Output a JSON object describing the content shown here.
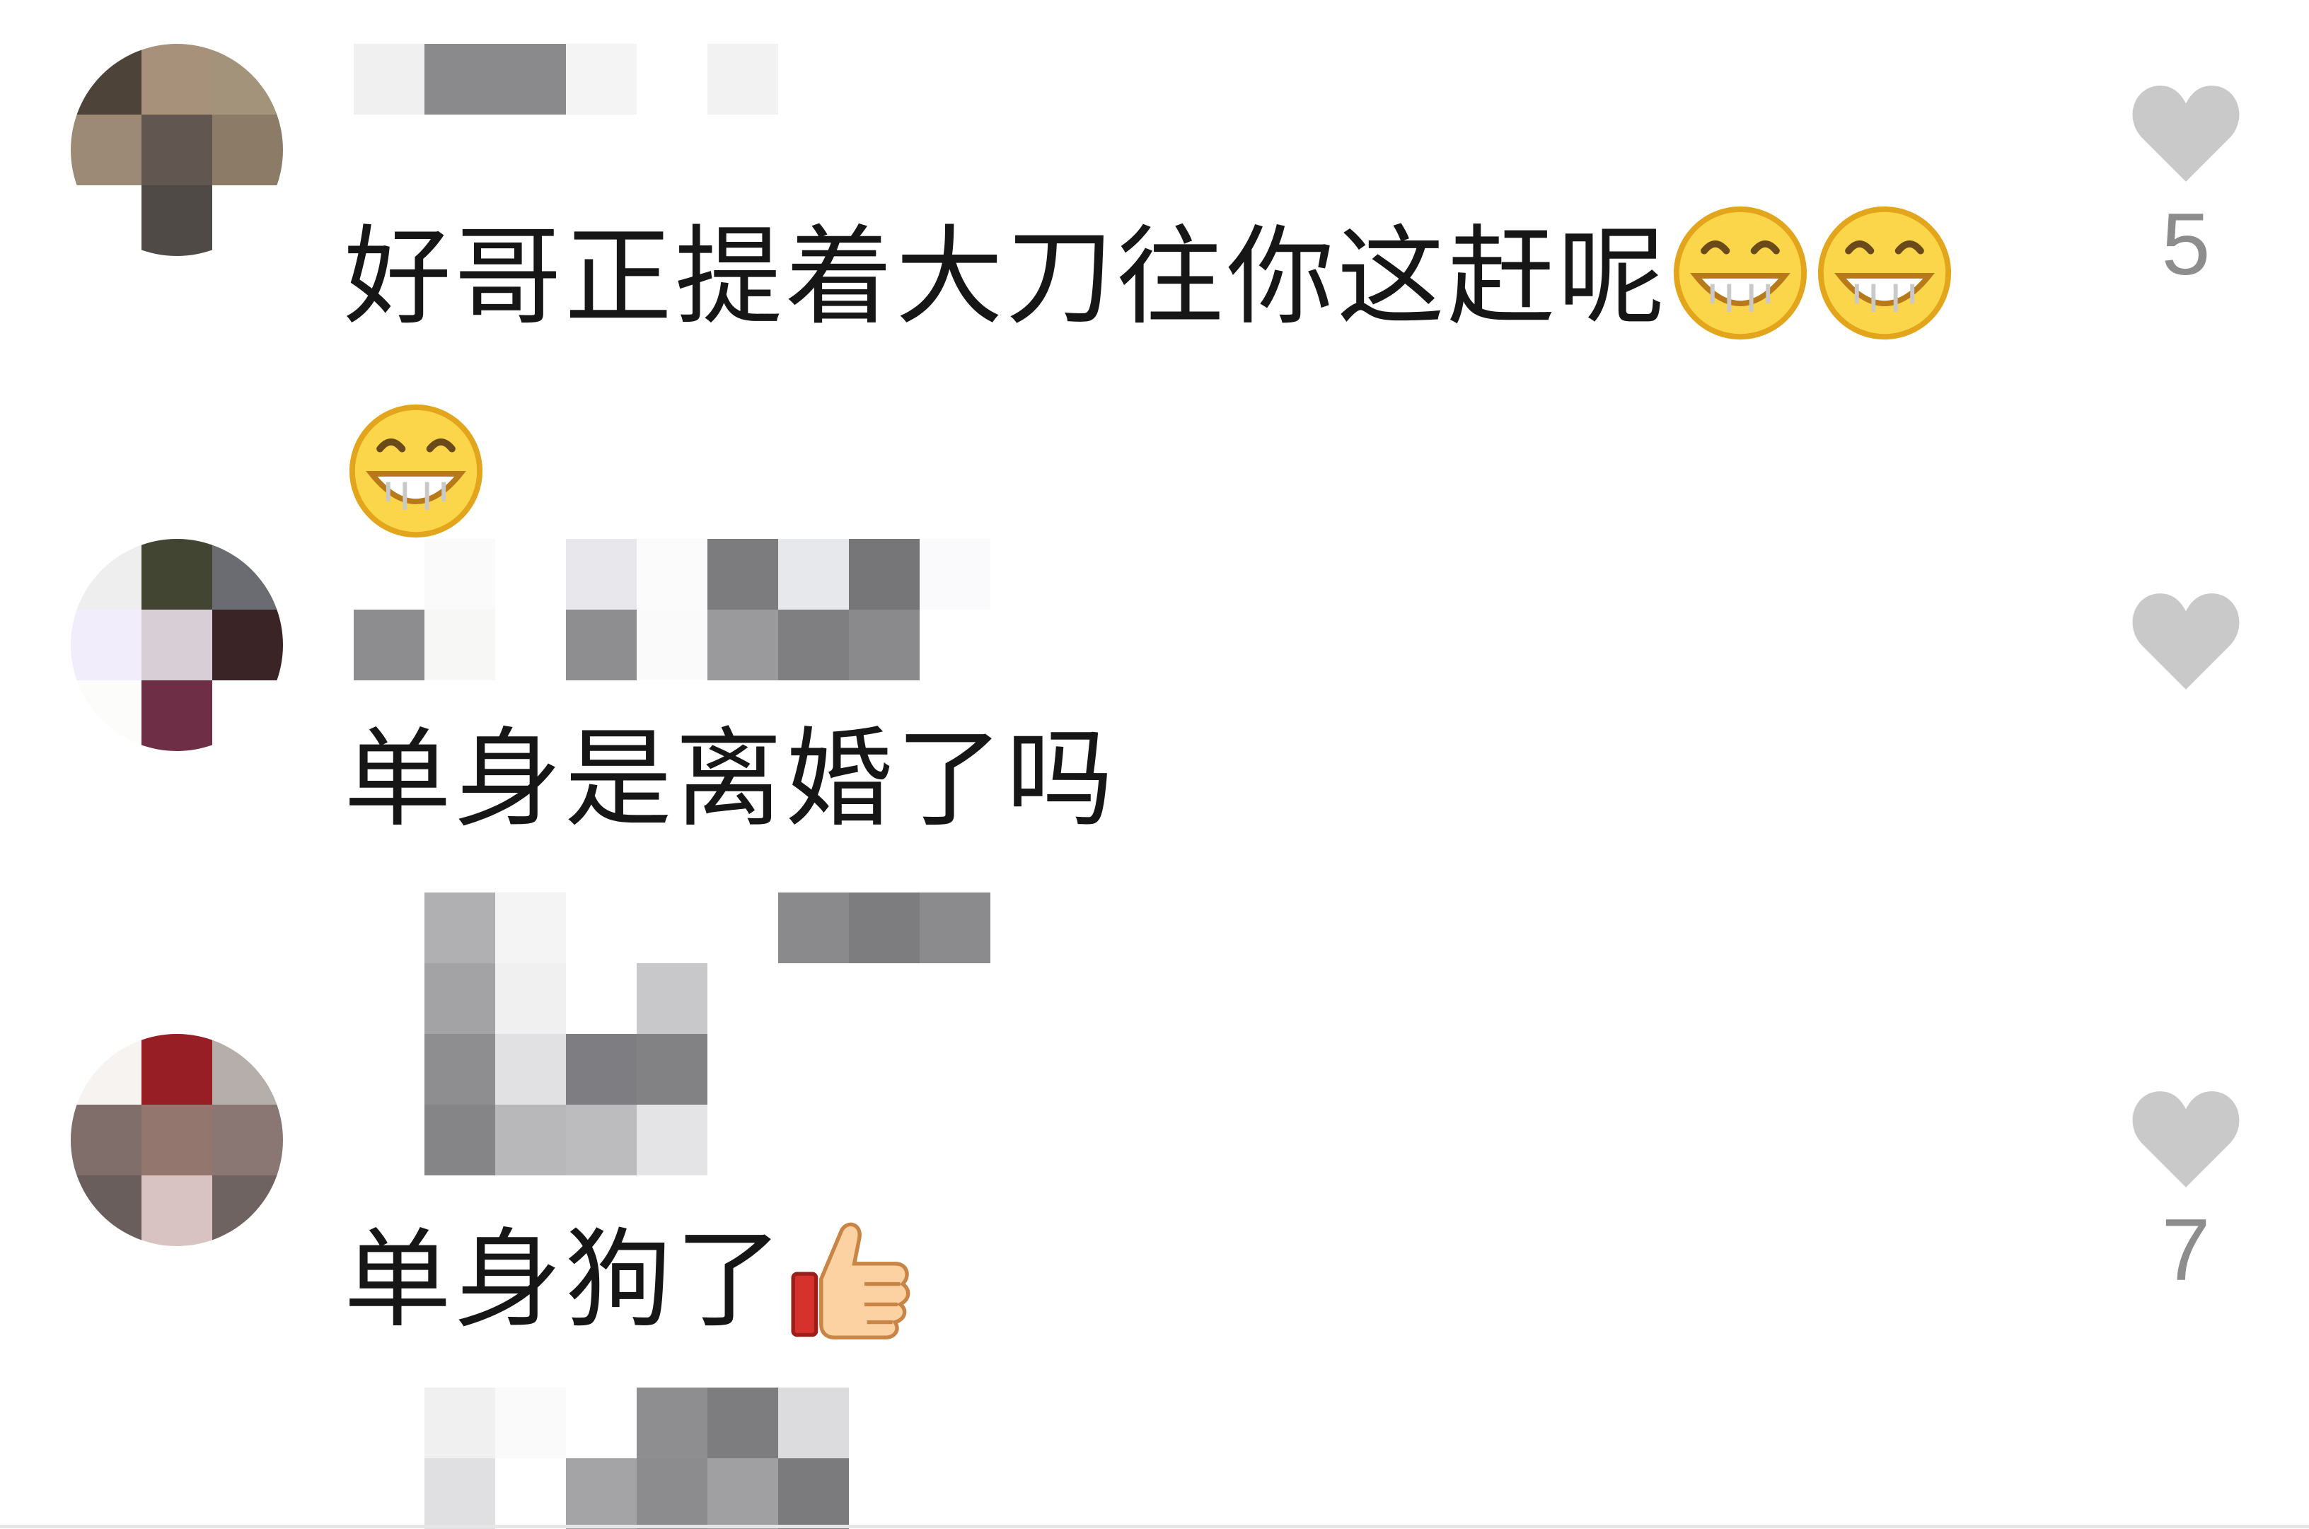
{
  "comments": [
    {
      "text": "好哥正提着大刀往你这赶呢",
      "emojis": [
        "grin-emoji",
        "grin-emoji",
        "grin-emoji"
      ],
      "likes": "5"
    },
    {
      "text": "单身是离婚了吗",
      "emojis": [],
      "likes": ""
    },
    {
      "text": "单身狗了",
      "emojis": [
        "thumbs-up-emoji"
      ],
      "likes": "7"
    }
  ],
  "colors": {
    "text": "#161616",
    "like_icon": "#c9c9c9",
    "like_count": "#8d8d8d",
    "emoji_face": "#fbd54a",
    "emoji_outline": "#e3a51b"
  },
  "icons": {
    "like": "heart-icon",
    "avatar": "pixelated-avatar",
    "username": "pixelated-username"
  }
}
